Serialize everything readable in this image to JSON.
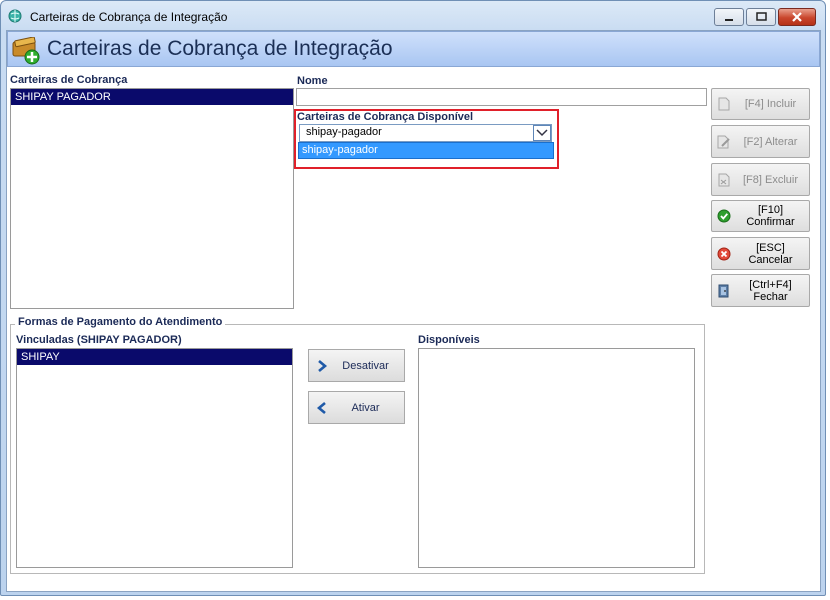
{
  "window": {
    "title": "Carteiras de Cobrança de Integração"
  },
  "banner": {
    "title": "Carteiras de Cobrança de Integração"
  },
  "left_list": {
    "label": "Carteiras de Cobrança",
    "items": [
      "SHIPAY PAGADOR"
    ]
  },
  "nome": {
    "label": "Nome",
    "value": ""
  },
  "disponivel": {
    "label": "Carteiras de Cobrança Disponível",
    "selected": "shipay-pagador",
    "options": [
      "shipay-pagador"
    ]
  },
  "actions": {
    "incluir": {
      "key": "[F4]",
      "label": "Incluir"
    },
    "alterar": {
      "key": "[F2]",
      "label": "Alterar"
    },
    "excluir": {
      "key": "[F8]",
      "label": "Excluir"
    },
    "confirmar": {
      "key": "[F10]",
      "label": "Confirmar"
    },
    "cancelar": {
      "key": "[ESC]",
      "label": "Cancelar"
    },
    "fechar": {
      "key": "[Ctrl+F4]",
      "label": "Fechar"
    }
  },
  "formas": {
    "group_title": "Formas de Pagamento do Atendimento",
    "vinculadas_label": "Vinculadas (SHIPAY PAGADOR)",
    "vinculadas_items": [
      "SHIPAY"
    ],
    "disponiveis_label": "Disponíveis",
    "desativar_label": "Desativar",
    "ativar_label": "Ativar"
  },
  "colors": {
    "selection": "#0a0a6b",
    "highlight_border": "#e0202a",
    "dropdown_selected": "#3399ff",
    "banner_text": "#1b2f55"
  }
}
